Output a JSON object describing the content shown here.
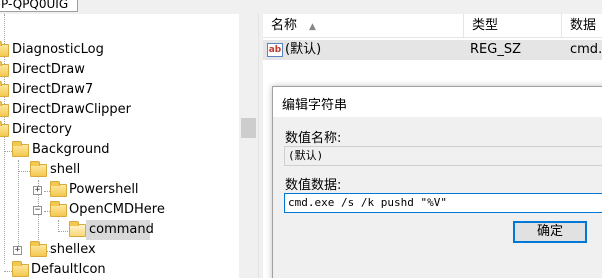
{
  "address_bar": {
    "text": "P-QPQ0UIG"
  },
  "tree": {
    "items": [
      {
        "label": "DiagnosticLog"
      },
      {
        "label": "DirectDraw"
      },
      {
        "label": "DirectDraw7"
      },
      {
        "label": "DirectDrawClipper"
      },
      {
        "label": "Directory"
      },
      {
        "label": "Background"
      },
      {
        "label": "shell"
      },
      {
        "label": "Powershell",
        "expander": "+"
      },
      {
        "label": "OpenCMDHere",
        "expander": "−"
      },
      {
        "label": "command",
        "selected": true
      },
      {
        "label": "shellex",
        "expander": "+"
      },
      {
        "label": "DefaultIcon"
      }
    ]
  },
  "list": {
    "columns": {
      "name": "名称",
      "type": "类型",
      "data": "数据"
    },
    "rows": [
      {
        "icon": "string-value-icon",
        "icon_text": "ab",
        "name": "(默认)",
        "type": "REG_SZ",
        "data": "cmd.e"
      }
    ]
  },
  "dialog": {
    "title": "编辑字符串",
    "value_name_label": "数值名称:",
    "value_name": "(默认)",
    "value_data_label": "数值数据:",
    "value_data": "cmd.exe /s /k pushd \"%V\"",
    "ok_label": "确定"
  },
  "colors": {
    "accent": "#0078d7",
    "selection": "#d9d9d9",
    "folder": "#f4c84f"
  }
}
